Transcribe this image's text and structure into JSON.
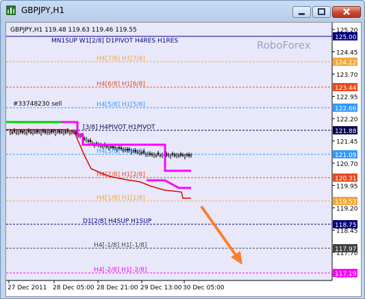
{
  "window": {
    "title": "GBPJPY,H1"
  },
  "chart": {
    "info": "GBPJPY,H1  119.48 119.63 119.46 119.55",
    "watermark": "RoboForex",
    "order_label": "#33748230 sell",
    "colors": {
      "background": "#e8e8fa",
      "candles": "#000000",
      "line_red": "#e00000",
      "line_magenta": "#ff00ff",
      "line_green": "#00d000",
      "arrow": "#ff7f2a"
    },
    "price_labels": [
      "125.20",
      "124.45",
      "123.70",
      "122.95",
      "122.20",
      "121.45",
      "120.70",
      "119.95",
      "119.20",
      "118.45",
      "117.70",
      "116.95"
    ],
    "tags": [
      {
        "text": "125.00",
        "bg": "#000080",
        "fg": "#ffffff"
      },
      {
        "text": "124.22",
        "bg": "#f2a63b",
        "fg": "#ffffff"
      },
      {
        "text": "123.44",
        "bg": "#e84a1e",
        "fg": "#ffffff"
      },
      {
        "text": "122.66",
        "bg": "#3399ff",
        "fg": "#ffffff"
      },
      {
        "text": "121.88",
        "bg": "#000050",
        "fg": "#ffffff"
      },
      {
        "text": "121.09",
        "bg": "#3399ff",
        "fg": "#ffffff"
      },
      {
        "text": "120.31",
        "bg": "#e84a1e",
        "fg": "#ffffff"
      },
      {
        "text": "119.53",
        "bg": "#f2a63b",
        "fg": "#ffffff"
      },
      {
        "text": "118.75",
        "bg": "#000080",
        "fg": "#ffffff"
      },
      {
        "text": "117.97",
        "bg": "#404040",
        "fg": "#ffffff"
      },
      {
        "text": "117.19",
        "bg": "#ff00ff",
        "fg": "#ffffff"
      }
    ],
    "levels": [
      {
        "label": "MN1SUP W1[2/8] D1PIVOT H4RES H1RES",
        "color": "#000080"
      },
      {
        "label": "H4[7/8] H1[7/8]",
        "color": "#f2a63b"
      },
      {
        "label": "H4[6/8] H1[6/8]",
        "color": "#e84a1e"
      },
      {
        "label": "H4[5/8] H1[5/8]",
        "color": "#3399ff"
      },
      {
        "label": "[3/8] H4PIVOT H1PIVOT",
        "color": "#000050"
      },
      {
        "label": "H4[3/8] H1[3/8]",
        "color": "#3399ff"
      },
      {
        "label": "H4[2/8] H1[2/8]",
        "color": "#e84a1e"
      },
      {
        "label": "H4[1/8] H1[1/8]",
        "color": "#f2a63b"
      },
      {
        "label": "D1[2/8] H4SUP H1SUP",
        "color": "#000080"
      },
      {
        "label": "H4[-1/8] H1[-1/8]",
        "color": "#404040"
      },
      {
        "label": "H4[-2/8] H1[-2/8]",
        "color": "#ff00ff"
      }
    ],
    "time_labels": [
      "27 Dec 2011",
      "28 Dec 05:00",
      "28 Dec 21:00",
      "29 Dec 13:00",
      "30 Dec 05:00"
    ]
  }
}
